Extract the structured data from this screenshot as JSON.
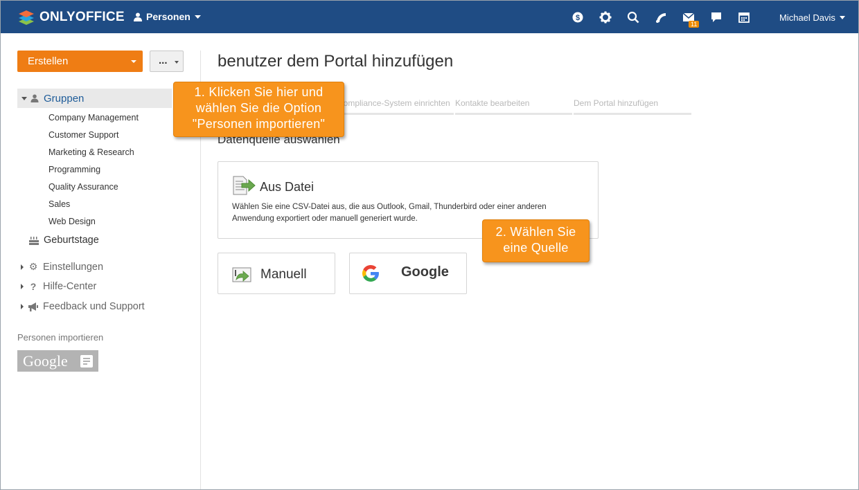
{
  "app": {
    "logo_text": "ONLYOFFICE",
    "module": "Personen",
    "user": "Michael Davis",
    "mail_badge": "11"
  },
  "toolbar": {
    "create_label": "Erstellen",
    "more_label": "..."
  },
  "sidebar": {
    "groups_label": "Gruppen",
    "groups": [
      "Company Management",
      "Customer Support",
      "Marketing & Research",
      "Programming",
      "Quality Assurance",
      "Sales",
      "Web Design"
    ],
    "birthdays": "Geburtstage",
    "nav": [
      {
        "label": "Einstellungen",
        "icon": "gear-icon"
      },
      {
        "label": "Hilfe-Center",
        "icon": "question-icon"
      },
      {
        "label": "Feedback und Support",
        "icon": "megaphone-icon"
      }
    ],
    "import_label": "Personen importieren",
    "google_label": "Google"
  },
  "main": {
    "title": "benutzer dem Portal hinzufügen",
    "steps": [
      "Compliance-System einrichten",
      "Kontakte bearbeiten",
      "Dem Portal hinzufügen"
    ],
    "section_title": "Datenquelle auswählen",
    "file_card": {
      "title": "Aus Datei",
      "description": "Wählen Sie eine CSV-Datei aus, die aus Outlook, Gmail, Thunderbird oder einer anderen Anwendung exportiert oder manuell generiert wurde."
    },
    "manual_label": "Manuell",
    "google_label": "Google"
  },
  "callouts": {
    "one": [
      "1. Klicken Sie hier und",
      "wählen Sie die Option",
      "\"Personen importieren\""
    ],
    "two": [
      "2. Wählen Sie",
      "eine Quelle"
    ]
  },
  "colors": {
    "topbar": "#1f4c84",
    "accent": "#ef7d14",
    "callout": "#f7941d",
    "link": "#1e5c99"
  }
}
